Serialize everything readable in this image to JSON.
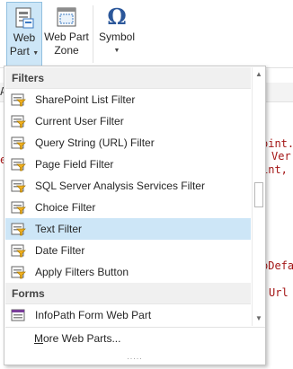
{
  "ribbon": {
    "web_part_line1": "Web",
    "web_part_line2": "Part",
    "web_part_zone_line1": "Web Part",
    "web_part_zone_line2": "Zone",
    "symbol_label": "Symbol",
    "symbol_glyph": "Ω"
  },
  "editor": {
    "fragments": [
      "A",
      "oint.",
      "Ver",
      "int,",
      "e",
      "oDefa",
      "Url"
    ]
  },
  "menu": {
    "groups": [
      {
        "header": "Filters",
        "items": [
          "SharePoint List Filter",
          "Current User Filter",
          "Query String (URL) Filter",
          "Page Field Filter",
          "SQL Server Analysis Services Filter",
          "Choice Filter",
          "Text Filter",
          "Date Filter",
          "Apply Filters Button"
        ]
      },
      {
        "header": "Forms",
        "items": [
          "InfoPath Form Web Part"
        ]
      }
    ],
    "selected_item": "Text Filter",
    "more_label": "More Web Parts...",
    "more_access_key": "M",
    "grip": "....."
  },
  "colors": {
    "selected_bg": "#cde6f7",
    "header_bg": "#f0f0f0",
    "symbol_blue": "#2b579a"
  }
}
